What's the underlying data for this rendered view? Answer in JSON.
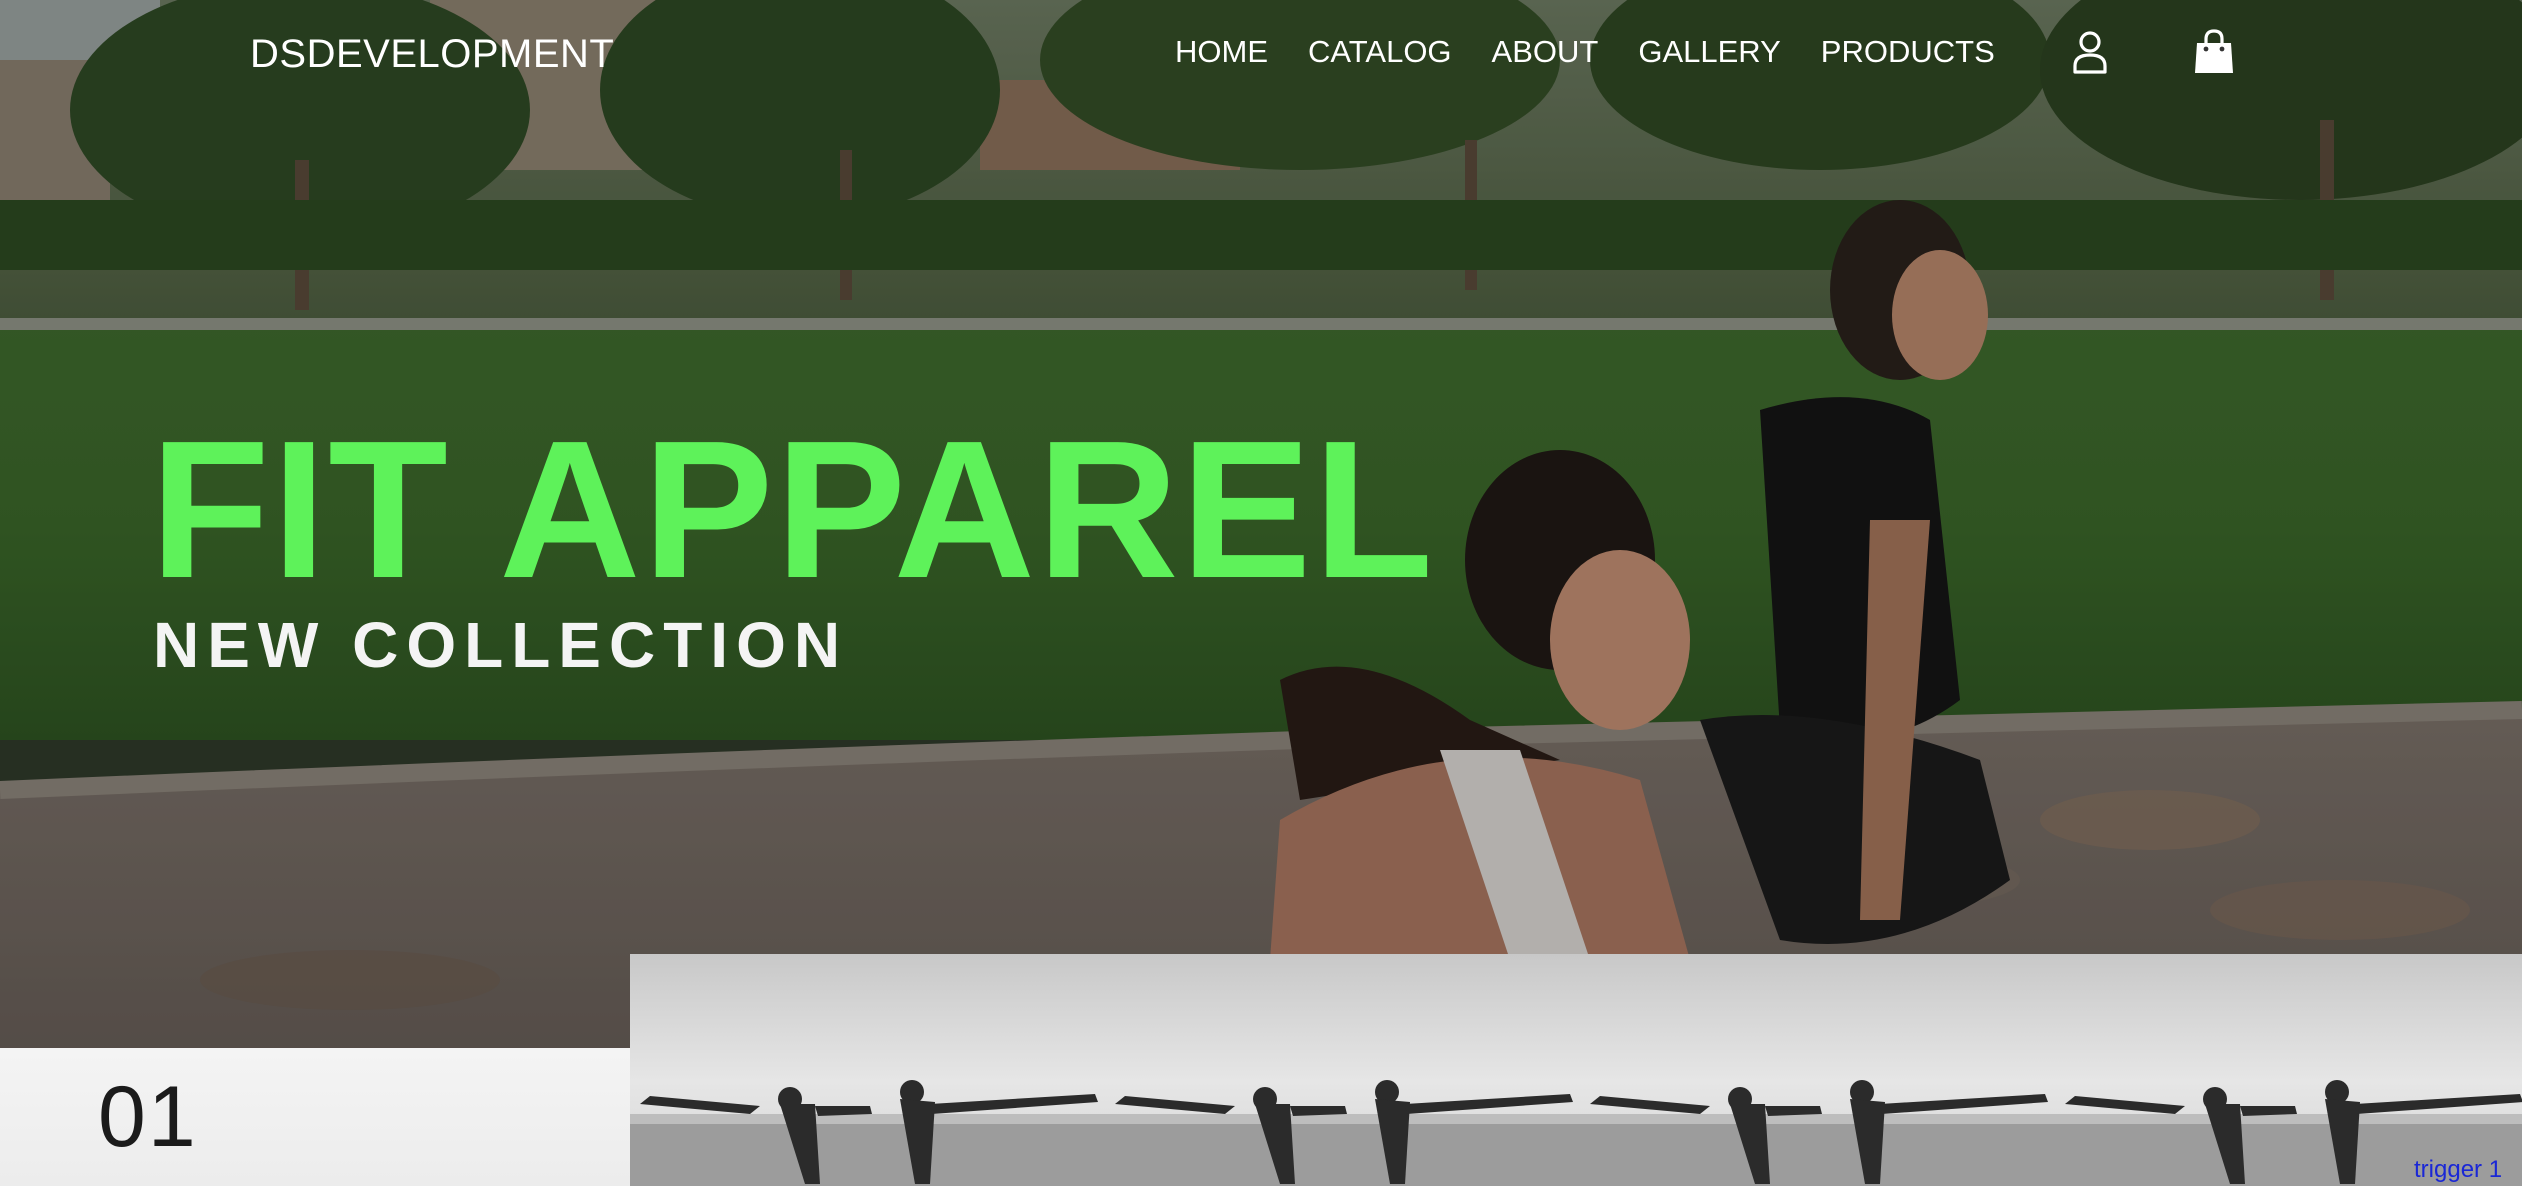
{
  "header": {
    "logo": "DSDEVELOPMENT",
    "nav": [
      "HOME",
      "CATALOG",
      "ABOUT",
      "GALLERY",
      "PRODUCTS"
    ],
    "icons": [
      "account-icon",
      "shopping-bag-icon"
    ]
  },
  "hero": {
    "title": "FIT APPAREL",
    "subtitle": "NEW COLLECTION"
  },
  "slider": {
    "index": "01",
    "trigger_label": "trigger 1"
  },
  "colors": {
    "accent": "#5ef25a",
    "header_text": "#ffffff",
    "trigger_link": "#1a27d6"
  }
}
